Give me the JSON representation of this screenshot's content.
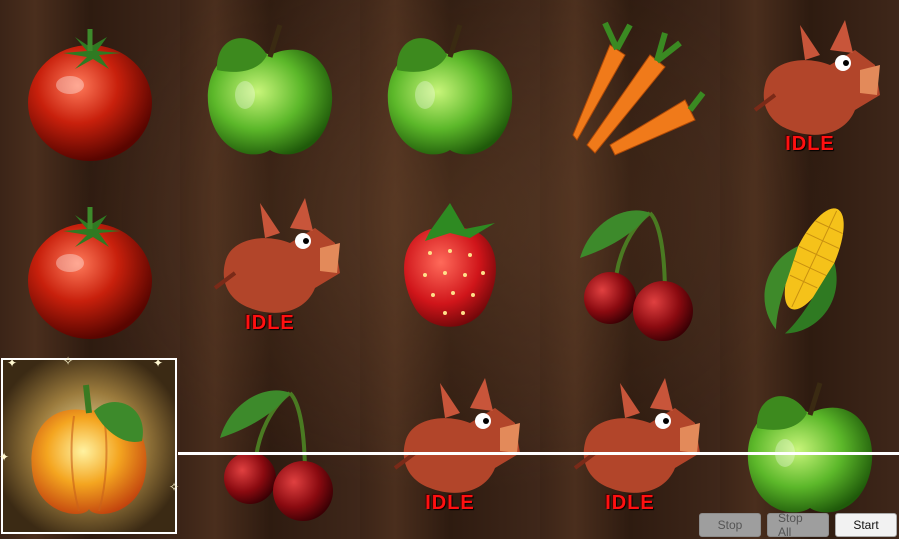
{
  "reels": {
    "idle_label": "IDLE",
    "symbols": [
      [
        "tomato-icon",
        "green-apple-icon",
        "green-apple-icon",
        "carrots-icon",
        "dragon-pig-icon"
      ],
      [
        "tomato-icon",
        "dragon-pig-icon",
        "strawberry-icon",
        "cherries-icon",
        "corn-icon"
      ],
      [
        "bell-pepper-icon",
        "cherries-icon",
        "dragon-pig-icon",
        "dragon-pig-icon",
        "green-apple-icon"
      ]
    ],
    "idle_cells": [
      [
        0,
        4
      ],
      [
        1,
        1
      ],
      [
        2,
        2
      ],
      [
        2,
        3
      ]
    ],
    "highlighted_cell": [
      2,
      0
    ]
  },
  "controls": {
    "stop_label": "Stop",
    "stop_all_label": "Stop All",
    "start_label": "Start"
  },
  "colors": {
    "idle_text": "#ff1010",
    "payline": "#ffffff"
  }
}
